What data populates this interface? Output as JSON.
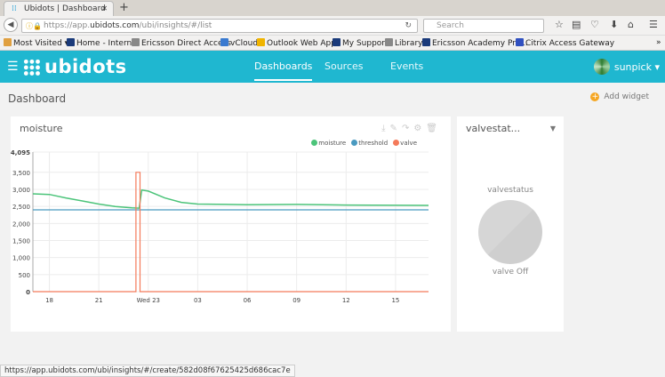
{
  "browser": {
    "tab_title": "Ubidots | Dashboard",
    "url_prefix": "https://app.",
    "url_domain": "ubidots.com",
    "url_path": "/ubi/insights/#/list",
    "search_placeholder": "Search",
    "bookmarks": [
      {
        "label": "Most Visited ▾",
        "color": "#e0a040"
      },
      {
        "label": "Home - Internal",
        "color": "#1a3a7a"
      },
      {
        "label": "Ericsson Direct Access",
        "color": "#888"
      },
      {
        "label": "vCloud",
        "color": "#3a7ad0"
      },
      {
        "label": "Outlook Web App",
        "color": "#f0b400"
      },
      {
        "label": "My Support",
        "color": "#1a3a7a"
      },
      {
        "label": "Library",
        "color": "#888"
      },
      {
        "label": "Ericsson Academy Pro...",
        "color": "#1a3a7a"
      },
      {
        "label": "Citrix Access Gateway",
        "color": "#3050c0"
      }
    ],
    "status_url": "https://app.ubidots.com/ubi/insights/#/create/582d08f67625425d686cac7e"
  },
  "app": {
    "logo": "ubidots",
    "nav": [
      "Dashboards",
      "Sources",
      "Events"
    ],
    "user": "sunpick ▾",
    "page_title": "Dashboard",
    "add_widget": "Add widget"
  },
  "chart_widget": {
    "title": "moisture"
  },
  "chart_data": {
    "type": "line",
    "title": "moisture",
    "xlabel": "",
    "ylabel": "",
    "ylim": [
      0,
      4095
    ],
    "yticks": [
      0,
      500,
      1000,
      1500,
      2000,
      2500,
      3000,
      3500,
      4095
    ],
    "xlim": [
      17,
      41
    ],
    "xticks": [
      {
        "x": 18,
        "label": "18"
      },
      {
        "x": 21,
        "label": "21"
      },
      {
        "x": 24,
        "label": "Wed 23"
      },
      {
        "x": 27,
        "label": "03"
      },
      {
        "x": 30,
        "label": "06"
      },
      {
        "x": 33,
        "label": "09"
      },
      {
        "x": 36,
        "label": "12"
      },
      {
        "x": 39,
        "label": "15"
      }
    ],
    "legend": "top-right",
    "series": [
      {
        "name": "moisture",
        "color": "#4cc47a",
        "x": [
          17,
          18,
          19,
          20,
          21,
          22,
          23,
          23.45,
          23.6,
          24,
          25,
          26,
          27,
          30,
          33,
          36,
          41
        ],
        "y": [
          2870,
          2850,
          2750,
          2660,
          2570,
          2500,
          2460,
          2450,
          2980,
          2950,
          2750,
          2620,
          2570,
          2550,
          2560,
          2540,
          2530
        ]
      },
      {
        "name": "threshold",
        "color": "#4a9ac0",
        "x": [
          17,
          41
        ],
        "y": [
          2400,
          2400
        ]
      },
      {
        "name": "valve",
        "color": "#f47a5a",
        "x": [
          17,
          23.25,
          23.25,
          23.5,
          23.5,
          41
        ],
        "y": [
          0,
          0,
          3500,
          3500,
          0,
          0
        ]
      }
    ]
  },
  "indicator_widget": {
    "title": "valvestat...",
    "variable": "valvestatus",
    "state": "valve Off"
  }
}
